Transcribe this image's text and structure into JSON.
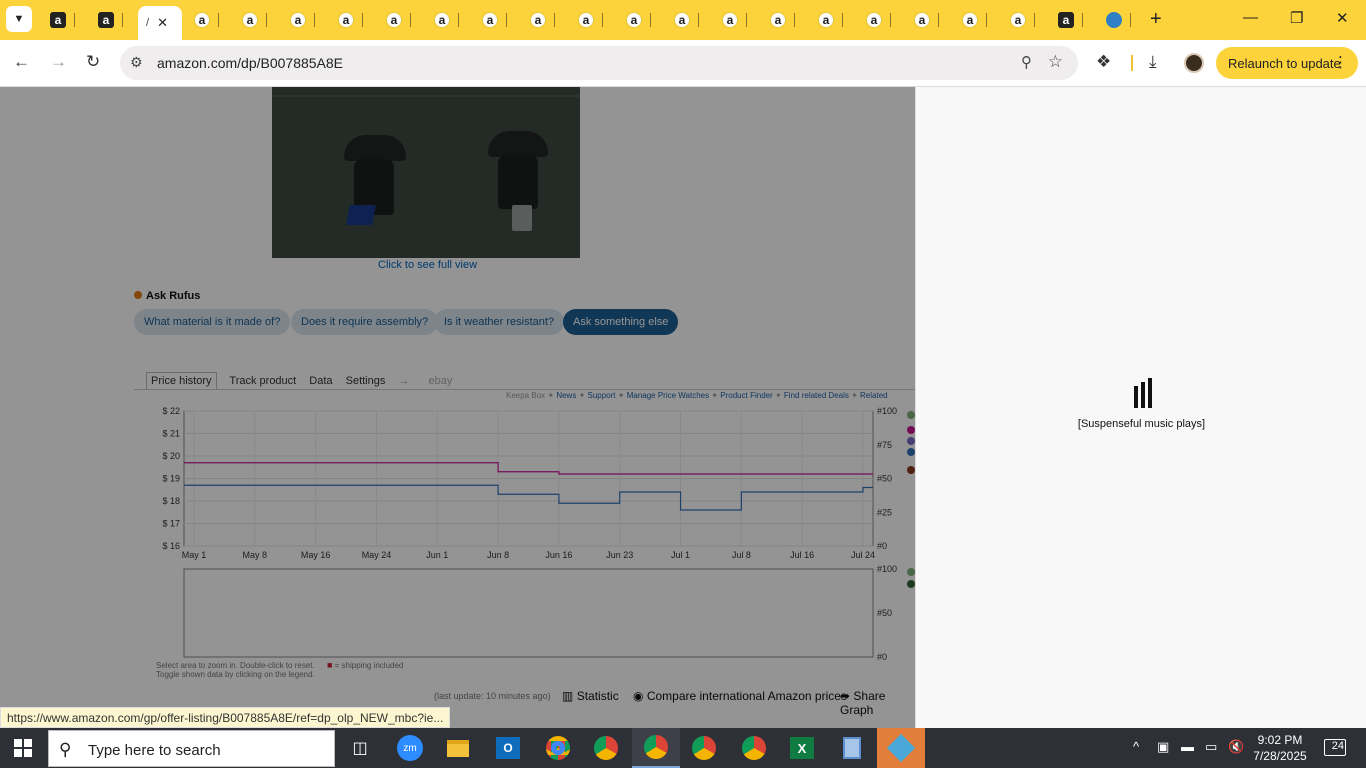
{
  "browser": {
    "tab_count_amazon": 20,
    "active_tab_label": "/",
    "omnibox": {
      "url": "amazon.com/dp/B007885A8E"
    },
    "relaunch_label": "Relaunch to update"
  },
  "page": {
    "full_view_link": "Click to see full view",
    "rufus": {
      "title": "Ask Rufus",
      "chips": [
        "What material is it made of?",
        "Does it require assembly?",
        "Is it weather resistant?",
        "Ask something else"
      ]
    },
    "keepa": {
      "tabs": [
        "Price history",
        "Track product",
        "Data",
        "Settings",
        "ebay"
      ],
      "links": [
        "Keepa Box",
        "News",
        "Support",
        "Manage Price Watches",
        "Product Finder",
        "Find related Deals",
        "Related"
      ],
      "note1": "Select area to zoom in. Double-click to reset.",
      "note_shipping": "= shipping included",
      "note2": "Toggle shown data by clicking on the legend.",
      "last_update": "(last update: 10 minutes ago)",
      "statistic": "Statistic",
      "compare": "Compare international Amazon prices",
      "share": "Share Graph"
    }
  },
  "chart_data": {
    "type": "line",
    "x": [
      "May 1",
      "May 8",
      "May 16",
      "May 24",
      "Jun 1",
      "Jun 8",
      "Jun 16",
      "Jun 23",
      "Jul 1",
      "Jul 8",
      "Jul 16",
      "Jul 24"
    ],
    "y_left_ticks": [
      "$ 22",
      "$ 21",
      "$ 20",
      "$ 19",
      "$ 18",
      "$ 17",
      "$ 16"
    ],
    "y_right_ticks": [
      "#100",
      "#75",
      "#50",
      "#25",
      "#0"
    ],
    "lower_right_ticks": [
      "#100",
      "#50",
      "#0"
    ],
    "ylim": [
      16,
      22
    ],
    "series": [
      {
        "color": "#c81894",
        "values": [
          19.7,
          19.7,
          19.7,
          19.7,
          19.7,
          19.3,
          19.2,
          19.2,
          19.2,
          19.2,
          19.2,
          19.2
        ]
      },
      {
        "color": "#3470b8",
        "values": [
          18.7,
          18.7,
          18.7,
          18.7,
          18.7,
          18.3,
          17.9,
          18.4,
          17.6,
          18.4,
          18.4,
          18.6
        ]
      }
    ]
  },
  "side_panel": {
    "caption": "[Suspenseful music plays]"
  },
  "status_bar": {
    "url": "https://www.amazon.com/gp/offer-listing/B007885A8E/ref=dp_olp_NEW_mbc?ie..."
  },
  "taskbar": {
    "search_placeholder": "Type here to search",
    "time": "9:02 PM",
    "date": "7/28/2025",
    "notifications": "24"
  }
}
